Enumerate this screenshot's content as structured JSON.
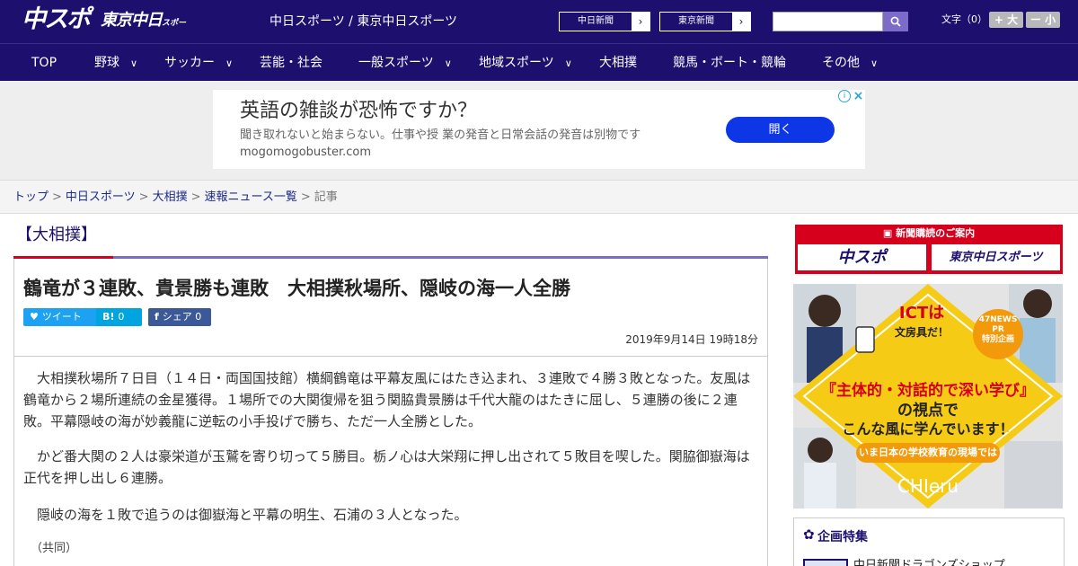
{
  "header": {
    "logo_chuspo": "中スポ",
    "logo_tokyo": "東京中日",
    "logo_tokyo_small": "スポーツ",
    "site_names": "中日スポーツ / 東京中日スポーツ",
    "paper_buttons": [
      "中日新聞",
      "東京新聞"
    ],
    "fontsize_label": "文字（0）",
    "fontsize_plus": "+ 大",
    "fontsize_minus": "ー 小"
  },
  "nav": {
    "items": [
      {
        "label": "TOP",
        "has_menu": false
      },
      {
        "label": "野球",
        "has_menu": true
      },
      {
        "label": "サッカー",
        "has_menu": true
      },
      {
        "label": "芸能・社会",
        "has_menu": false
      },
      {
        "label": "一般スポーツ",
        "has_menu": true
      },
      {
        "label": "地域スポーツ",
        "has_menu": true
      },
      {
        "label": "大相撲",
        "has_menu": false
      },
      {
        "label": "競馬・ボート・競輪",
        "has_menu": false
      },
      {
        "label": "その他",
        "has_menu": true
      }
    ]
  },
  "ad": {
    "title": "英語の雑談が恐怖ですか？",
    "description": "聞き取れないと始まらない。仕事や授 業の発音と日常会話の発音は別物です",
    "url": "mogomogobuster.com",
    "open_label": "開く"
  },
  "breadcrumb": {
    "items": [
      "トップ",
      "中日スポーツ",
      "大相撲",
      "速報ニュース一覧"
    ],
    "current": "記事"
  },
  "article": {
    "category": "【大相撲】",
    "headline": "鶴竜が３連敗、貴景勝も連敗　大相撲秋場所、隠岐の海一人全勝",
    "share": {
      "tweet_label": "ツイート",
      "hatena_label": "B!",
      "hatena_count": "0",
      "facebook_label": "シェア",
      "facebook_count": "0"
    },
    "date": "2019年9月14日 19時18分",
    "paragraphs": [
      "大相撲秋場所７日目（１４日・両国国技館）横綱鶴竜は平幕友風にはたき込まれ、３連敗で４勝３敗となった。友風は鶴竜から２場所連続の金星獲得。１場所での大関復帰を狙う関脇貴景勝は千代大龍のはたきに屈し、５連勝の後に２連敗。平幕隠岐の海が妙義龍に逆転の小手投げで勝ち、ただ一人全勝とした。",
      "かど番大関の２人は豪栄道が玉鷲を寄り切って５勝目。栃ノ心は大栄翔に押し出されて５敗目を喫した。関脇御嶽海は正代を押し出し６連勝。",
      "隠岐の海を１敗で追うのは御嶽海と平幕の明生、石浦の３人となった。"
    ],
    "credit": "（共同）"
  },
  "sidebar": {
    "subscribe_title": "新聞購読のご案内",
    "subscribe_logos": [
      "中スポ",
      "東京中日スポーツ"
    ],
    "banner": {
      "ict_title": "ICTは",
      "ict_sub": "文房具だ！",
      "badge_1": "47NEWS",
      "badge_2": "PR",
      "badge_3": "特別企画",
      "headline_1": "『主体的・対話的で深い学び』",
      "headline_2": "の視点で",
      "headline_3": "こんな風に学んでいます！",
      "ribbon": "いま日本の学校教育の現場では",
      "brand": "CHIeru"
    },
    "plan_title": "企画特集",
    "plan_item": "中日新聞ドラゴンズショップ"
  },
  "colors": {
    "brand_navy": "#1c0f6e",
    "accent_red": "#d6001c",
    "accent_purple": "#7d6bc9",
    "ad_button": "#0d36e6"
  }
}
